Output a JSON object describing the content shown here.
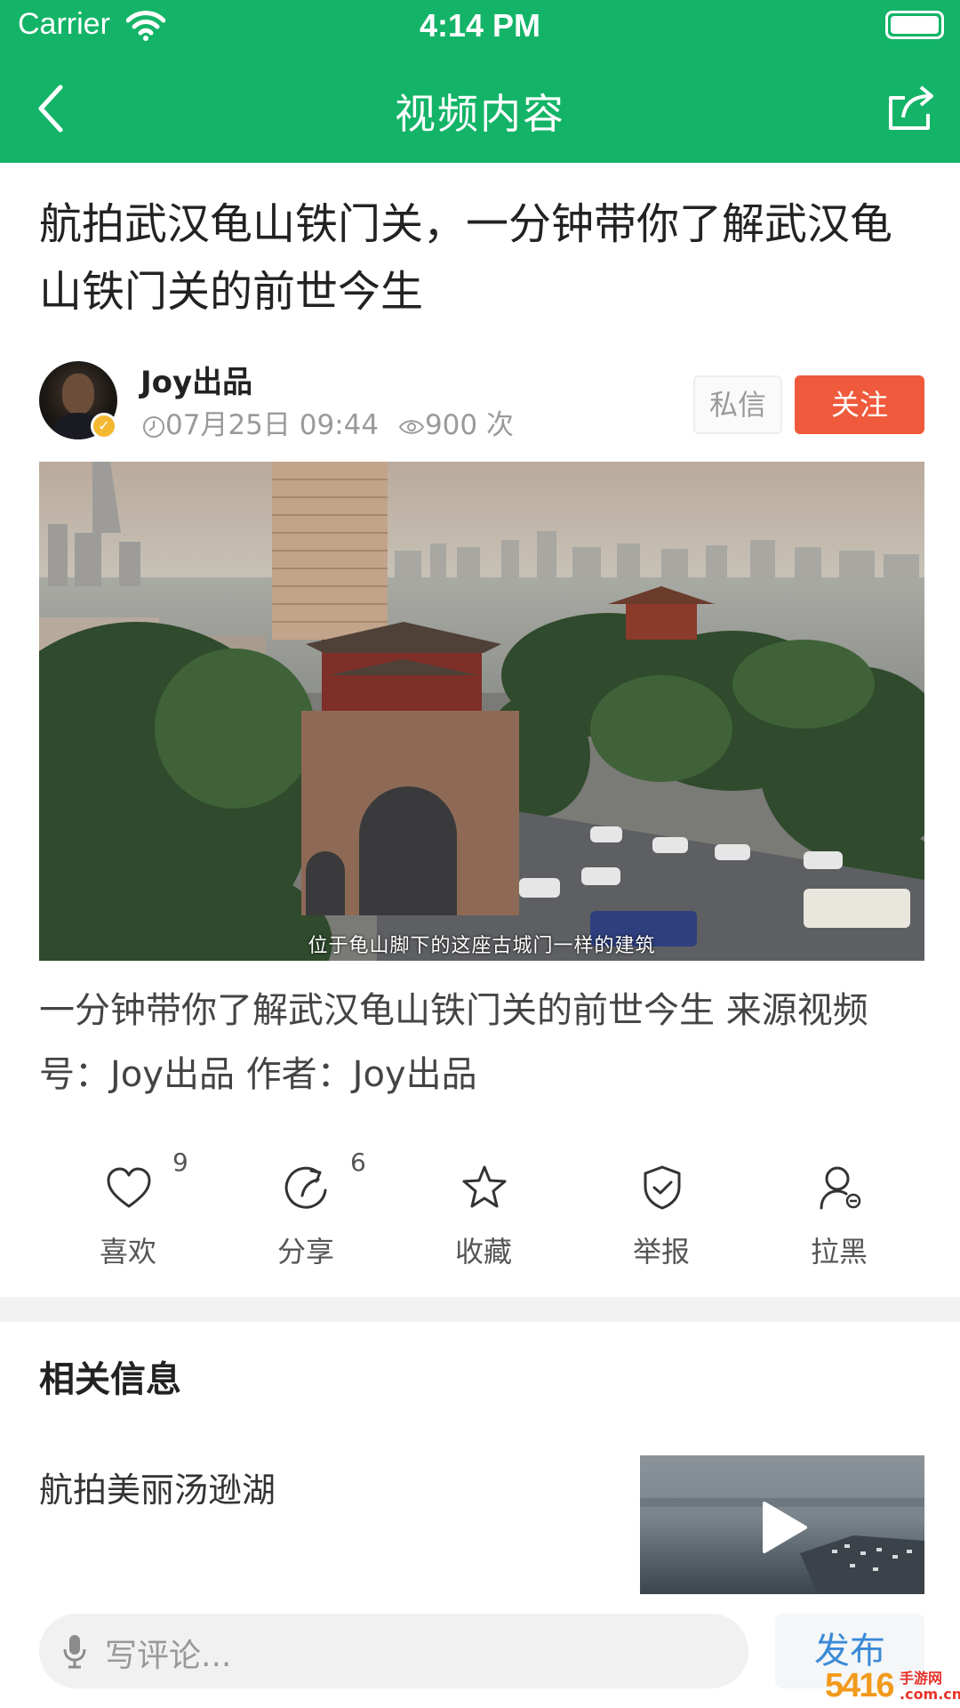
{
  "status_bar": {
    "carrier": "Carrier",
    "time": "4:14 PM"
  },
  "nav": {
    "title": "视频内容",
    "background_color": "#14b468"
  },
  "article": {
    "title": "航拍武汉龟山铁门关，一分钟带你了解武汉龟山铁门关的前世今生",
    "author": {
      "name": "Joy出品",
      "date": "07月25日 09:44",
      "views": "900 次",
      "verified": true
    },
    "buttons": {
      "message": "私信",
      "follow": "关注",
      "follow_color": "#ef5a3c"
    },
    "video": {
      "caption": "位于龟山脚下的这座古城门一样的建筑"
    },
    "description": "一分钟带你了解武汉龟山铁门关的前世今生 来源视频号：Joy出品 作者：Joy出品"
  },
  "actions": [
    {
      "label": "喜欢",
      "icon": "heart-icon",
      "count": "9"
    },
    {
      "label": "分享",
      "icon": "share-icon",
      "count": "6"
    },
    {
      "label": "收藏",
      "icon": "star-icon",
      "count": ""
    },
    {
      "label": "举报",
      "icon": "shield-icon",
      "count": ""
    },
    {
      "label": "拉黑",
      "icon": "block-user-icon",
      "count": ""
    }
  ],
  "related": {
    "heading": "相关信息",
    "items": [
      {
        "title": "航拍美丽汤逊湖"
      }
    ]
  },
  "comment_bar": {
    "placeholder": "写评论...",
    "publish_label": "发布",
    "publish_color": "#3b8ad6"
  },
  "watermark": {
    "number": "5416",
    "text_line1": "手游网",
    "text_line2": ".com.cn"
  }
}
